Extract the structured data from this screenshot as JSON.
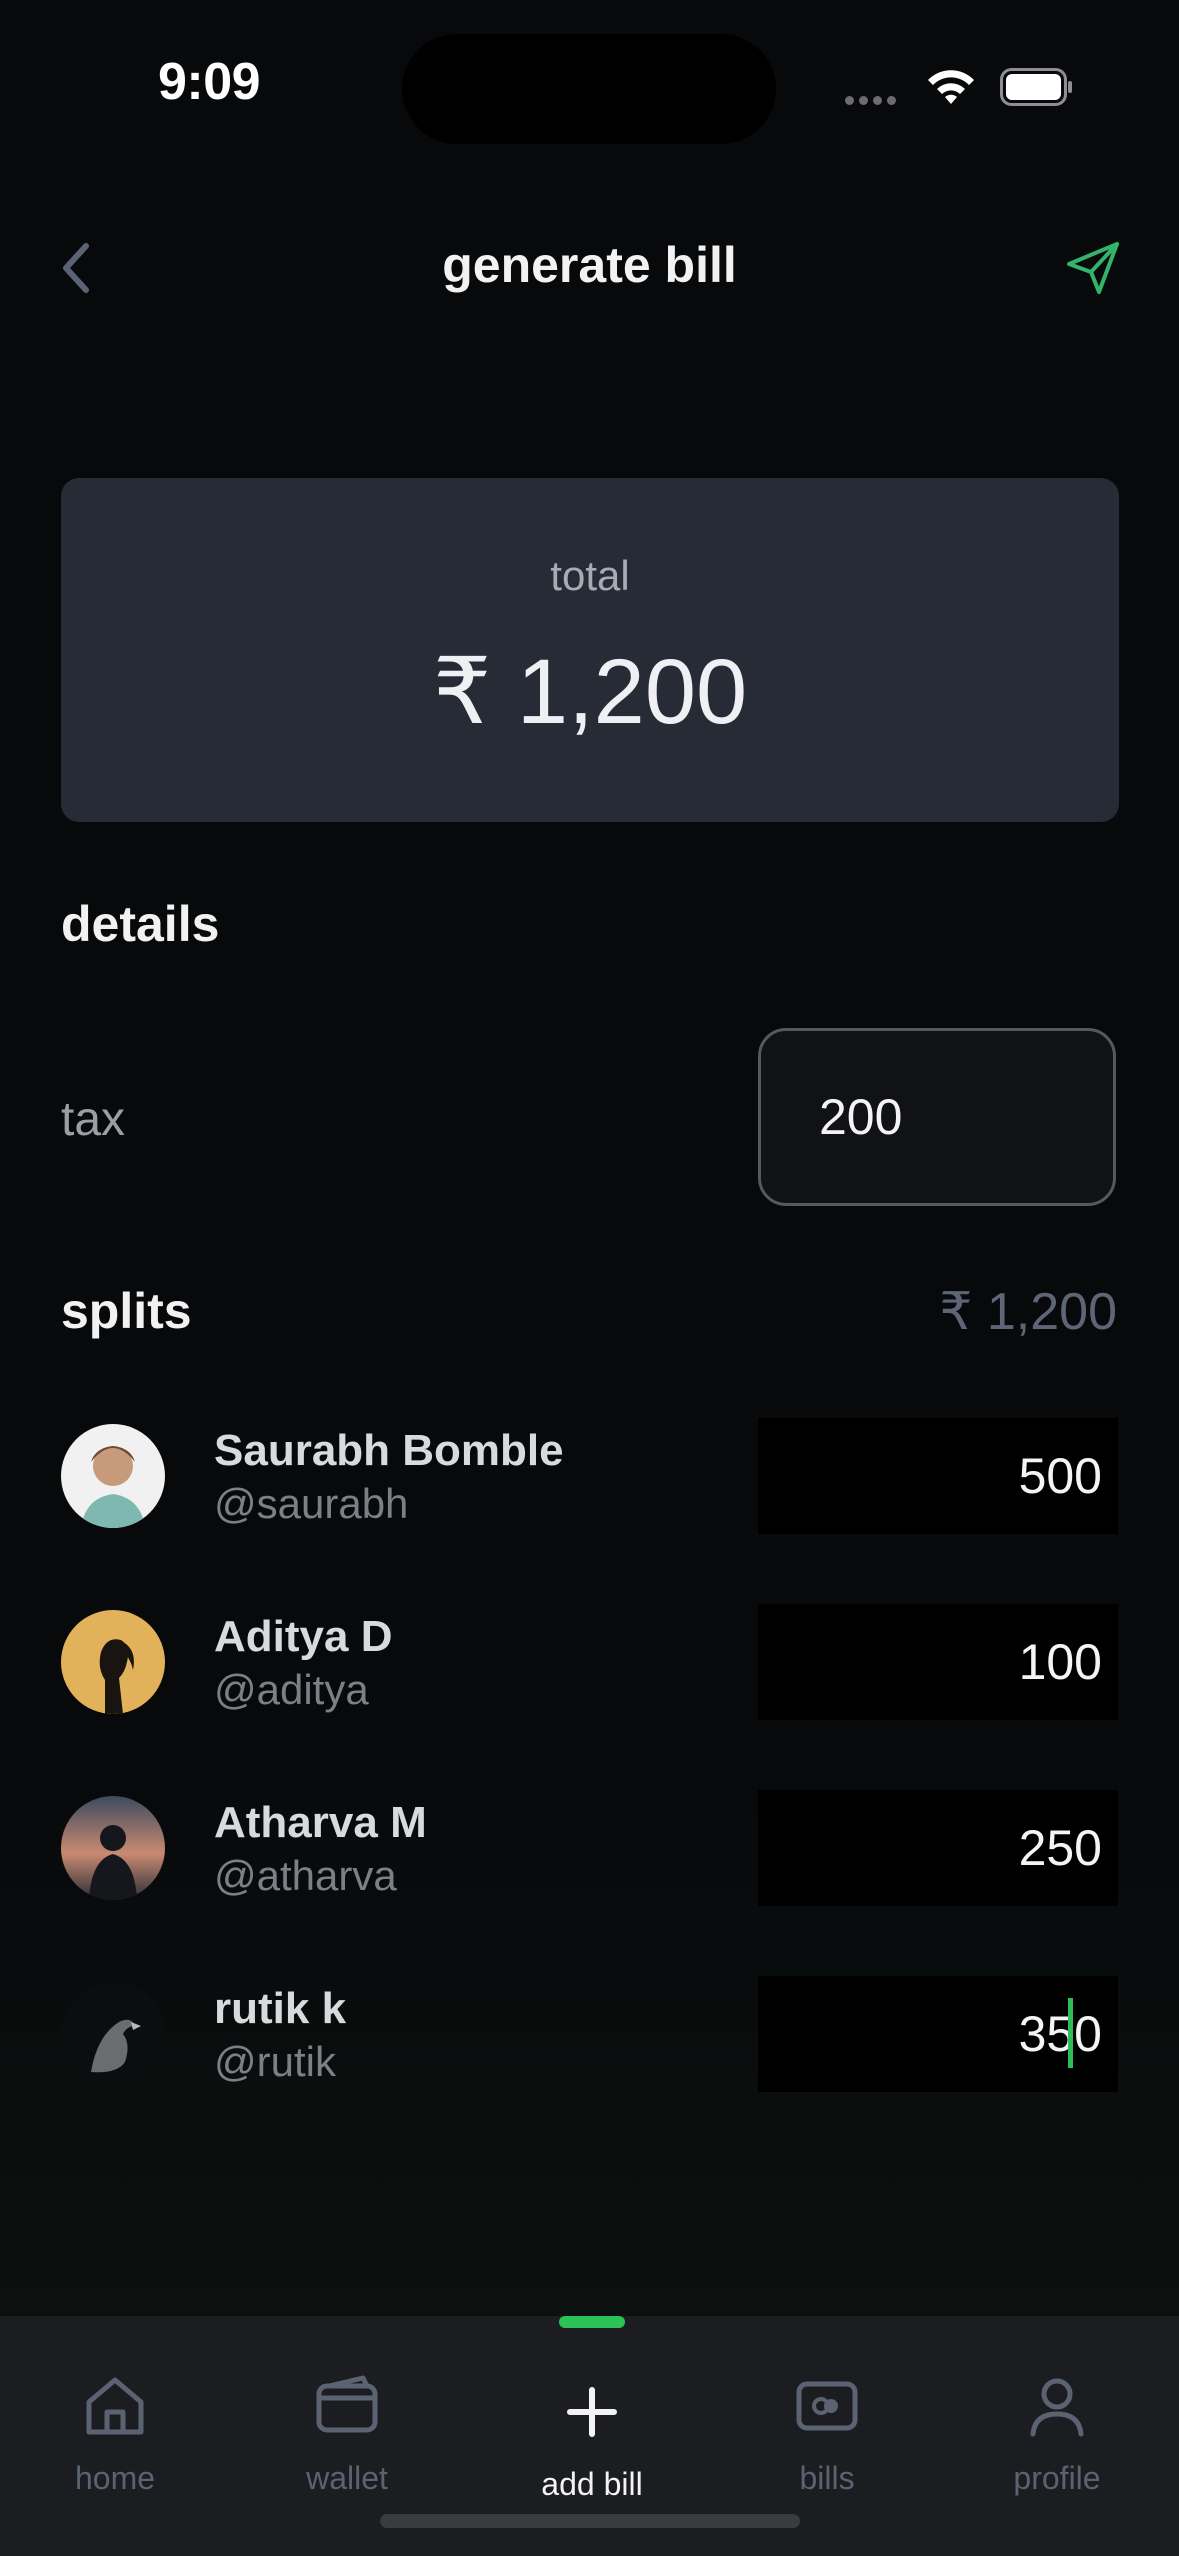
{
  "status_bar": {
    "time": "9:09"
  },
  "header": {
    "title": "generate bill"
  },
  "total": {
    "label": "total",
    "amount": "₹ 1,200"
  },
  "details": {
    "heading": "details",
    "tax_label": "tax",
    "tax_value": "200"
  },
  "splits": {
    "heading": "splits",
    "total": "₹ 1,200",
    "members": [
      {
        "name": "Saurabh Bomble",
        "handle": "@saurabh",
        "amount": "500"
      },
      {
        "name": "Aditya D",
        "handle": "@aditya",
        "amount": "100"
      },
      {
        "name": "Atharva M",
        "handle": "@atharva",
        "amount": "250"
      },
      {
        "name": "rutik k",
        "handle": "@rutik",
        "amount": "350"
      }
    ]
  },
  "tabs": [
    {
      "label": "home",
      "icon": "home-icon"
    },
    {
      "label": "wallet",
      "icon": "wallet-icon"
    },
    {
      "label": "add bill",
      "icon": "plus-icon",
      "active": true
    },
    {
      "label": "bills",
      "icon": "bills-icon"
    },
    {
      "label": "profile",
      "icon": "profile-icon"
    }
  ],
  "colors": {
    "accent": "#2bc258",
    "send_icon": "#34b36a",
    "card": "#272b35",
    "background": "#08090b"
  }
}
